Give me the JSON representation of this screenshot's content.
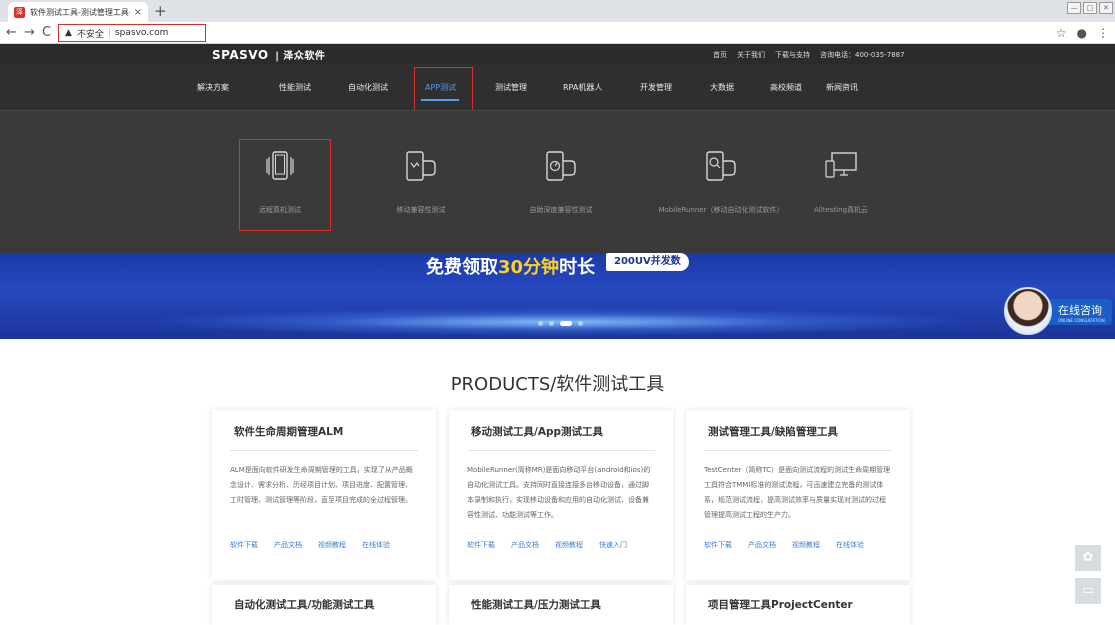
{
  "browser": {
    "tab_title": "软件测试工具-测试管理工具-自动化...",
    "favicon_text": "泽",
    "close_glyph": "×",
    "new_tab_glyph": "+",
    "back_glyph": "←",
    "forward_glyph": "→",
    "reload_glyph": "C",
    "warning_glyph": "▲",
    "security_label": "不安全",
    "url": "spasvo.com",
    "star_glyph": "☆",
    "profile_glyph": "●",
    "menu_glyph": "⋮",
    "win_min": "—",
    "win_max": "□",
    "win_close": "✕"
  },
  "site": {
    "logo": "SPASVO",
    "logo_cn": "| 泽众软件",
    "top_links": [
      "首页",
      "关于我们",
      "下载与支持",
      "咨询电话：400-035-7887"
    ]
  },
  "nav": {
    "items": [
      "解决方案",
      "性能测试",
      "自动化测试",
      "APP测试",
      "测试管理",
      "RPA机器人",
      "开发管理",
      "大数据",
      "高校频道",
      "新闻资讯"
    ]
  },
  "mega_menu": {
    "items": [
      {
        "label": "远程真机测试",
        "icon": "remote-device-icon"
      },
      {
        "label": "移动兼容性测试",
        "icon": "mobile-compat-icon"
      },
      {
        "label": "自助深度兼容性测试",
        "icon": "deep-compat-icon"
      },
      {
        "label": "MobileRunner（移动自动化测试软件）",
        "icon": "mobile-search-icon"
      },
      {
        "label": "Alltesting真机云",
        "icon": "device-cloud-icon"
      }
    ]
  },
  "banner": {
    "title_pre": "免费领取",
    "title_highlight": "30分钟",
    "title_post": "时长",
    "badge": "200UV并发数"
  },
  "consult": {
    "label": "在线咨询",
    "sub": "ONLINE CONSULTATION"
  },
  "products": {
    "title": "PRODUCTS/软件测试工具",
    "cards": [
      {
        "title": "软件生命周期管理ALM",
        "desc": "ALM是面向软件研发生命周期管理的工具，实现了从产品概念设计、需求分析、历经项目计划、项目进度、配置管理、工时管理、测试管理等阶段，直至项目完成的全过程管理。",
        "links": [
          "软件下载",
          "产品文档",
          "视频教程",
          "在线体验"
        ]
      },
      {
        "title": "移动测试工具/App测试工具",
        "desc": "MobileRunner(简称MR)是面向移动平台(android和ios)的自动化测试工具。支持同时直接连接多台移动设备，通过脚本录制和执行，实现移动设备和应用的自动化测试、设备兼容性测试、功能测试等工作。",
        "links": [
          "软件下载",
          "产品文档",
          "视频教程",
          "快速入门"
        ]
      },
      {
        "title": "测试管理工具/缺陷管理工具",
        "desc": "TestCenter（简称TC）是面向测试流程的测试生命周期管理工具符合TMMI标准的测试流程，可迅速建立完备的测试体系，规范测试流程，提高测试效率与质量实现对测试的过程管理提高测试工程的生产力。",
        "links": [
          "软件下载",
          "产品文档",
          "视频教程",
          "在线体验"
        ]
      }
    ],
    "row2": [
      "自动化测试工具/功能测试工具",
      "性能测试工具/压力测试工具",
      "项目管理工具ProjectCenter"
    ]
  }
}
